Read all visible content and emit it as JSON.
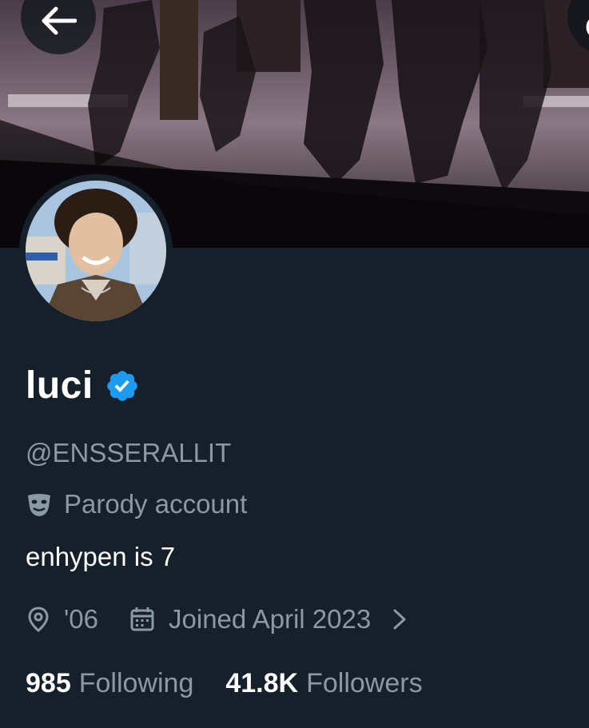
{
  "profile": {
    "display_name": "luci",
    "handle": "@ENSSERALLIT",
    "verified_icon": "verified-badge-icon",
    "verified_color": "#1d9bf0",
    "account_label": "Parody account",
    "bio": "enhypen is 7",
    "location": "'06",
    "joined": "Joined April 2023",
    "following_count": "985",
    "following_label": "Following",
    "followers_count": "41.8K",
    "followers_label": "Followers"
  },
  "icons": {
    "back": "arrow-left-icon",
    "search": "search-icon",
    "parody": "masks-icon",
    "location": "location-pin-icon",
    "calendar": "calendar-icon",
    "chevron": "chevron-right-icon"
  },
  "colors": {
    "background": "#15202b",
    "secondary_text": "#8b98a5",
    "primary_text": "#ffffff"
  }
}
